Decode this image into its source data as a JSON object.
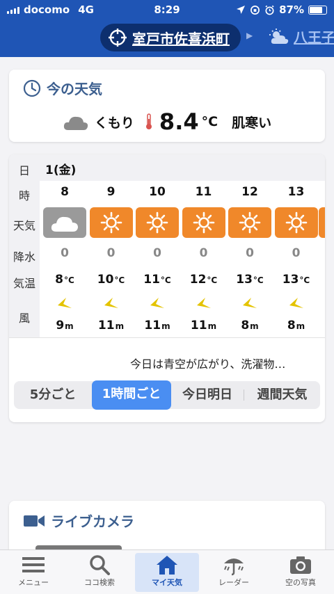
{
  "status_bar": {
    "carrier": "docomo",
    "network": "4G",
    "time": "8:29",
    "battery": "87%",
    "battery_level": 0.87
  },
  "header": {
    "location": "室戸市佐喜浜町",
    "next_location": "八王子"
  },
  "now": {
    "title": "今の天気",
    "condition": "くもり",
    "temperature": "8.4",
    "unit": "°C",
    "feel": "肌寒い"
  },
  "hourly": {
    "labels": {
      "day": "日",
      "hour": "時",
      "weather": "天気",
      "precip": "降水",
      "temp": "気温",
      "wind": "風"
    },
    "date": "1(金)",
    "hours": [
      {
        "hour": "8",
        "weather": "cloudy",
        "precip": "0",
        "temp": "8",
        "wind": "9"
      },
      {
        "hour": "9",
        "weather": "sunny",
        "precip": "0",
        "temp": "10",
        "wind": "11"
      },
      {
        "hour": "10",
        "weather": "sunny",
        "precip": "0",
        "temp": "11",
        "wind": "11"
      },
      {
        "hour": "11",
        "weather": "sunny",
        "precip": "0",
        "temp": "12",
        "wind": "11"
      },
      {
        "hour": "12",
        "weather": "sunny",
        "precip": "0",
        "temp": "13",
        "wind": "8"
      },
      {
        "hour": "13",
        "weather": "sunny",
        "precip": "0",
        "temp": "13",
        "wind": "8"
      }
    ],
    "temp_unit": "°C",
    "wind_unit": "m",
    "summary": "今日は青空が広がり、洗濯物…",
    "segments": [
      "5分ごと",
      "1時間ごと",
      "今日明日",
      "週間天気"
    ],
    "active_segment": "1時間ごと"
  },
  "camera": {
    "title": "ライブカメラ"
  },
  "tabs": [
    {
      "label": "メニュー",
      "icon": "menu-icon"
    },
    {
      "label": "ココ検索",
      "icon": "search-icon"
    },
    {
      "label": "マイ天気",
      "icon": "home-icon"
    },
    {
      "label": "レーダー",
      "icon": "radar-umbrella-icon"
    },
    {
      "label": "空の写真",
      "icon": "camera-icon"
    }
  ],
  "colors": {
    "header": "#1f55b5",
    "sunny": "#f0882a",
    "cloudy": "#9a9a9a",
    "accent": "#4a8ef2",
    "wind": "#e4c300"
  }
}
